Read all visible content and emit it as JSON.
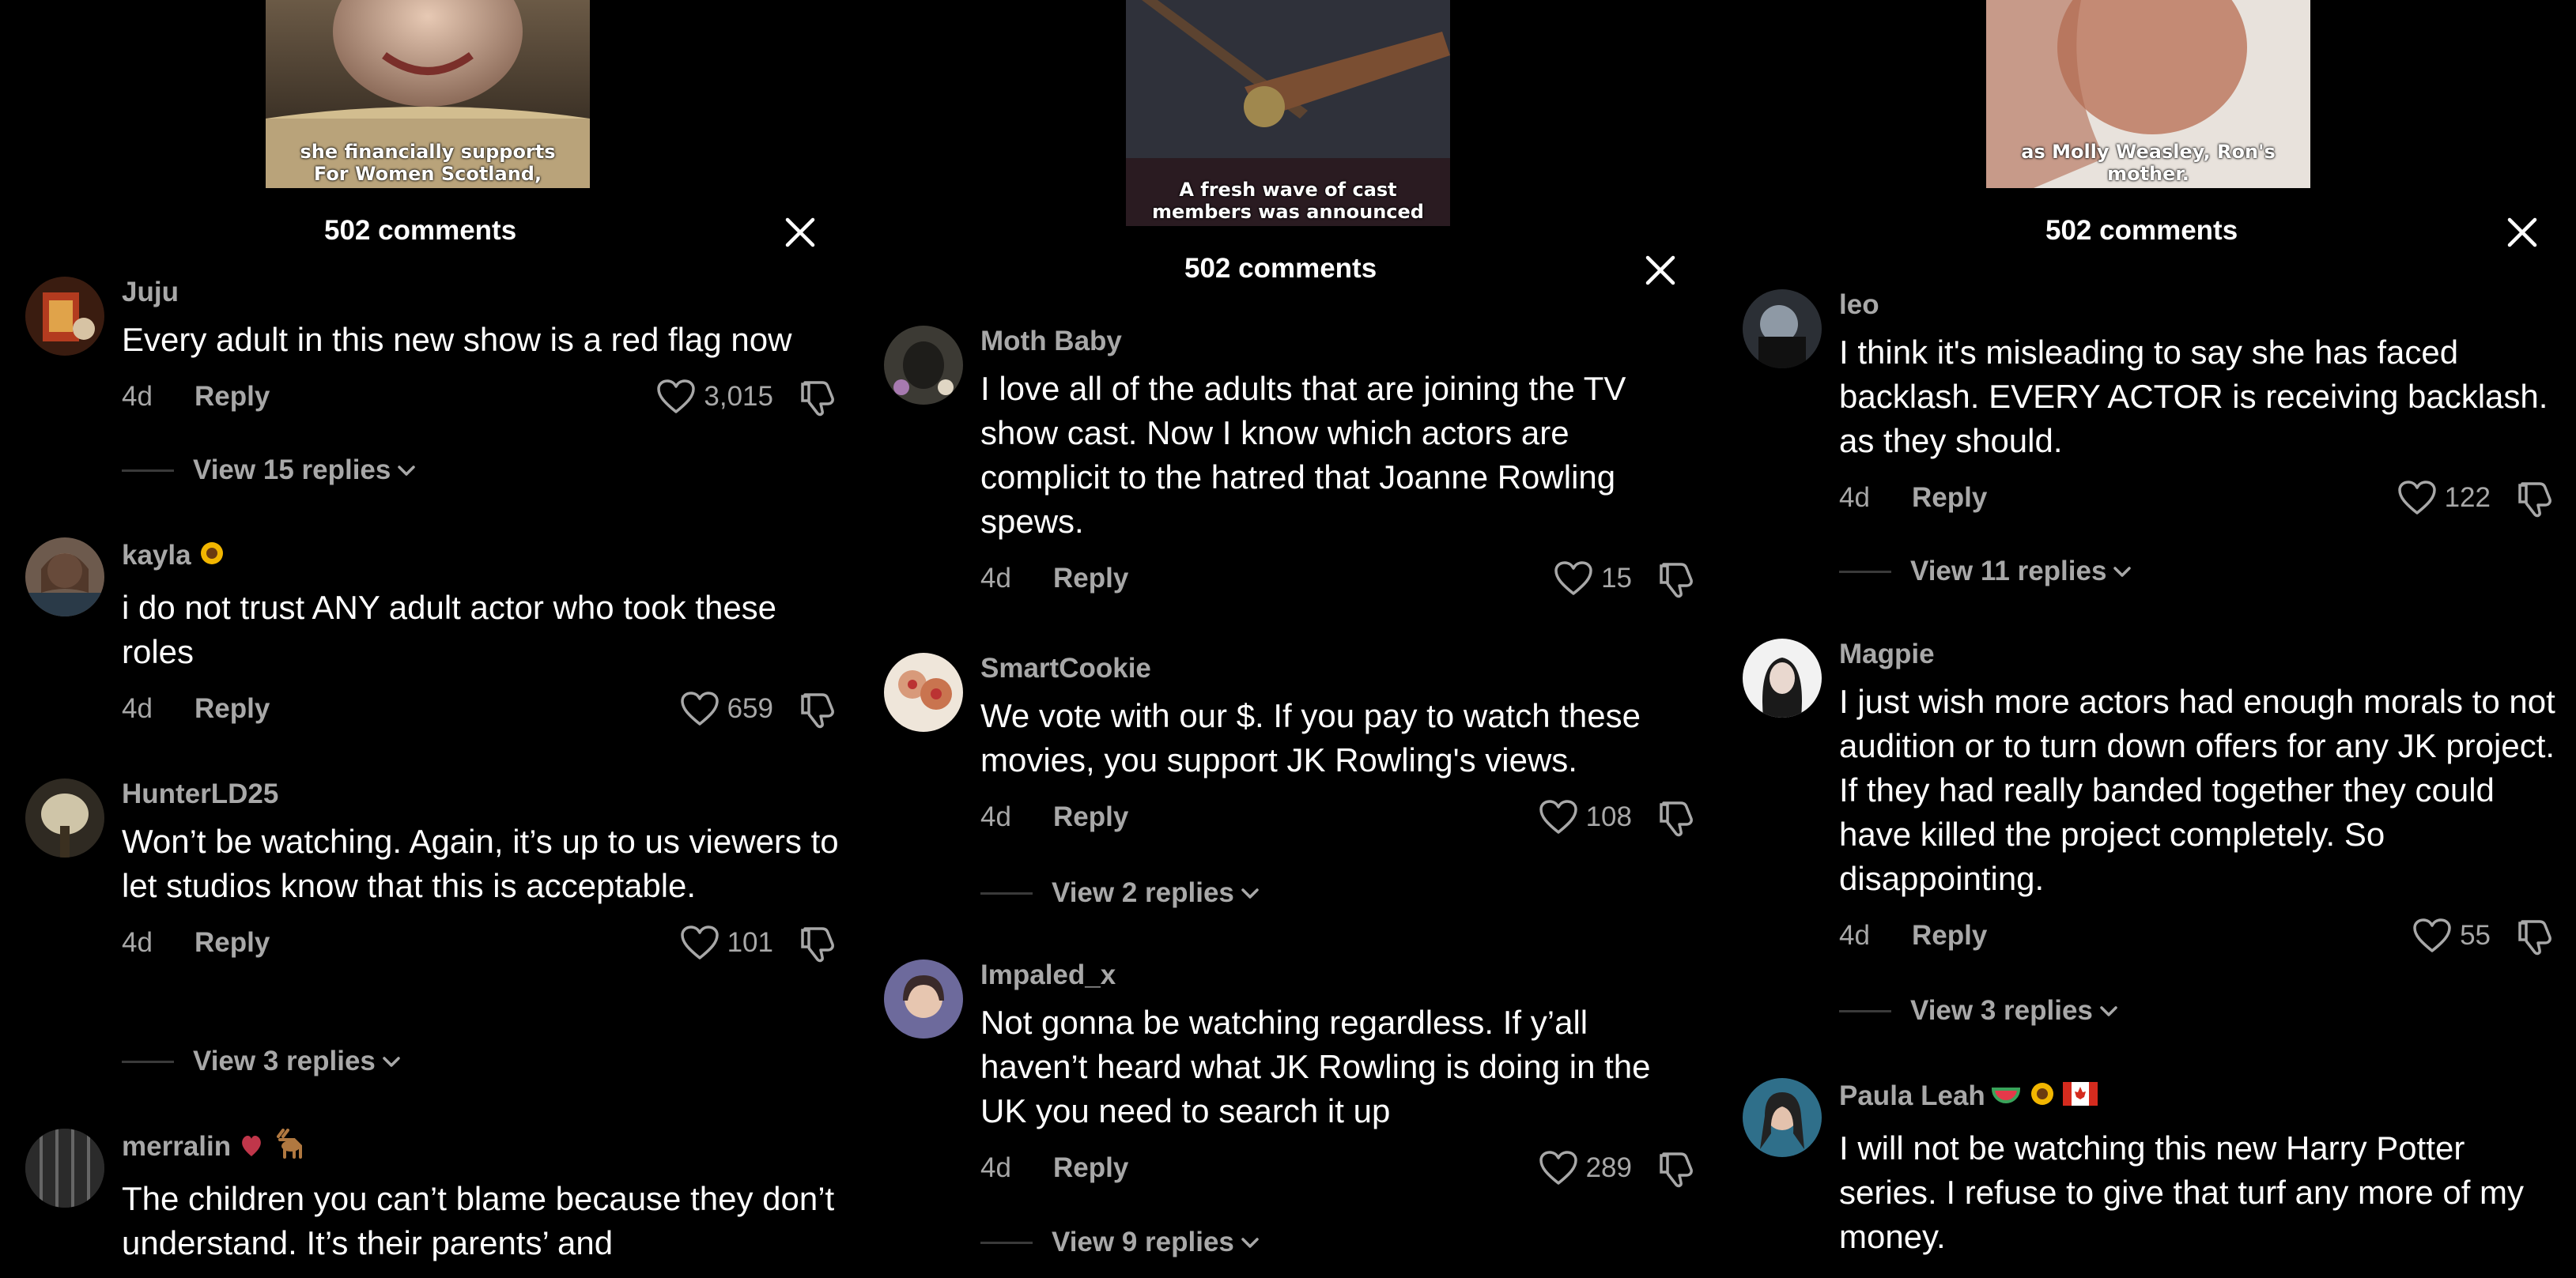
{
  "panels": [
    {
      "thumb_caption": "she financially supports For Women Scotland,",
      "header": "502 comments",
      "comments": [
        {
          "user": "Juju",
          "text": "Every adult in this new show is a red flag now",
          "time": "4d",
          "reply": "Reply",
          "likes": "3,015",
          "replies": "View 15 replies"
        },
        {
          "user": "kayla",
          "text": "i do not trust ANY adult actor who took these roles",
          "time": "4d",
          "reply": "Reply",
          "likes": "659"
        },
        {
          "user": "HunterLD25",
          "text": "Won’t be watching. Again, it’s up to us viewers to let studios know that this is acceptable.",
          "time": "4d",
          "reply": "Reply",
          "likes": "101",
          "replies": "View 3 replies"
        },
        {
          "user": "merralin",
          "text": "The children you can’t blame because they don’t understand. It’s their parents’ and"
        }
      ]
    },
    {
      "thumb_caption": "A fresh wave of cast members was announced",
      "header": "502 comments",
      "comments": [
        {
          "user": "Moth Baby",
          "text": "I love all of the adults that are joining the TV show cast. Now I know which actors are complicit to the hatred that Joanne Rowling spews.",
          "time": "4d",
          "reply": "Reply",
          "likes": "15"
        },
        {
          "user": "SmartCookie",
          "text": "We vote with our $. If you pay to watch these movies, you support JK Rowling's views.",
          "time": "4d",
          "reply": "Reply",
          "likes": "108",
          "replies": "View 2 replies"
        },
        {
          "user": "Impaled_x",
          "text": "Not gonna be watching regardless. If y’all haven’t heard what JK Rowling is doing in the UK you need to search it up",
          "time": "4d",
          "reply": "Reply",
          "likes": "289",
          "replies": "View 9 replies"
        }
      ]
    },
    {
      "thumb_caption": "as Molly Weasley, Ron's mother.",
      "header": "502 comments",
      "comments": [
        {
          "user": "leo",
          "text": "I think it's misleading to say she has faced backlash. EVERY ACTOR is receiving backlash. as they should.",
          "time": "4d",
          "reply": "Reply",
          "likes": "122",
          "replies": "View 11 replies"
        },
        {
          "user": "Magpie",
          "text": "I just wish more actors had enough morals to not audition or to turn down offers for any JK project. If they had really banded together they could have killed the project completely. So disappointing.",
          "time": "4d",
          "reply": "Reply",
          "likes": "55",
          "replies": "View 3 replies"
        },
        {
          "user": "Paula Leah",
          "text": "I will not be watching this new Harry Potter series. I refuse to give that turf any more of my money."
        }
      ]
    }
  ],
  "icons": {
    "like": "heart-outline-icon",
    "dislike": "thumbs-down-icon",
    "close": "close-icon",
    "chevron": "chevron-down-icon"
  },
  "colors": {
    "background": "#000000",
    "text_primary": "#ffffff",
    "text_secondary": "#a8a8a8"
  }
}
